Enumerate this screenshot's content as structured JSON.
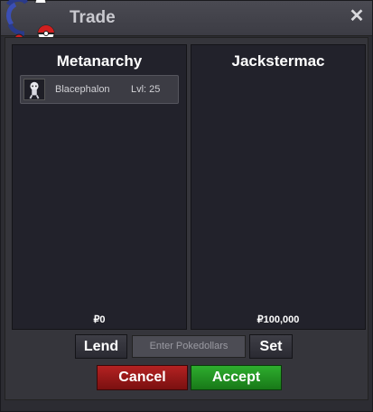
{
  "window": {
    "title": "Trade"
  },
  "left_panel": {
    "name": "Metanarchy",
    "items": [
      {
        "name": "Blacephalon",
        "level": "Lvl: 25"
      }
    ],
    "money": "₽0"
  },
  "right_panel": {
    "name": "Jackstermac",
    "money": "₽100,000"
  },
  "controls": {
    "lend_label": "Lend",
    "money_input_placeholder": "Enter Pokedollars",
    "set_label": "Set",
    "cancel_label": "Cancel",
    "accept_label": "Accept"
  },
  "icons": {
    "logo": "pokeball-logo-icon",
    "close": "close-icon",
    "item": "blacephalon-sprite-icon"
  },
  "colors": {
    "cancel": "#a81c1c",
    "accept": "#28a028"
  }
}
